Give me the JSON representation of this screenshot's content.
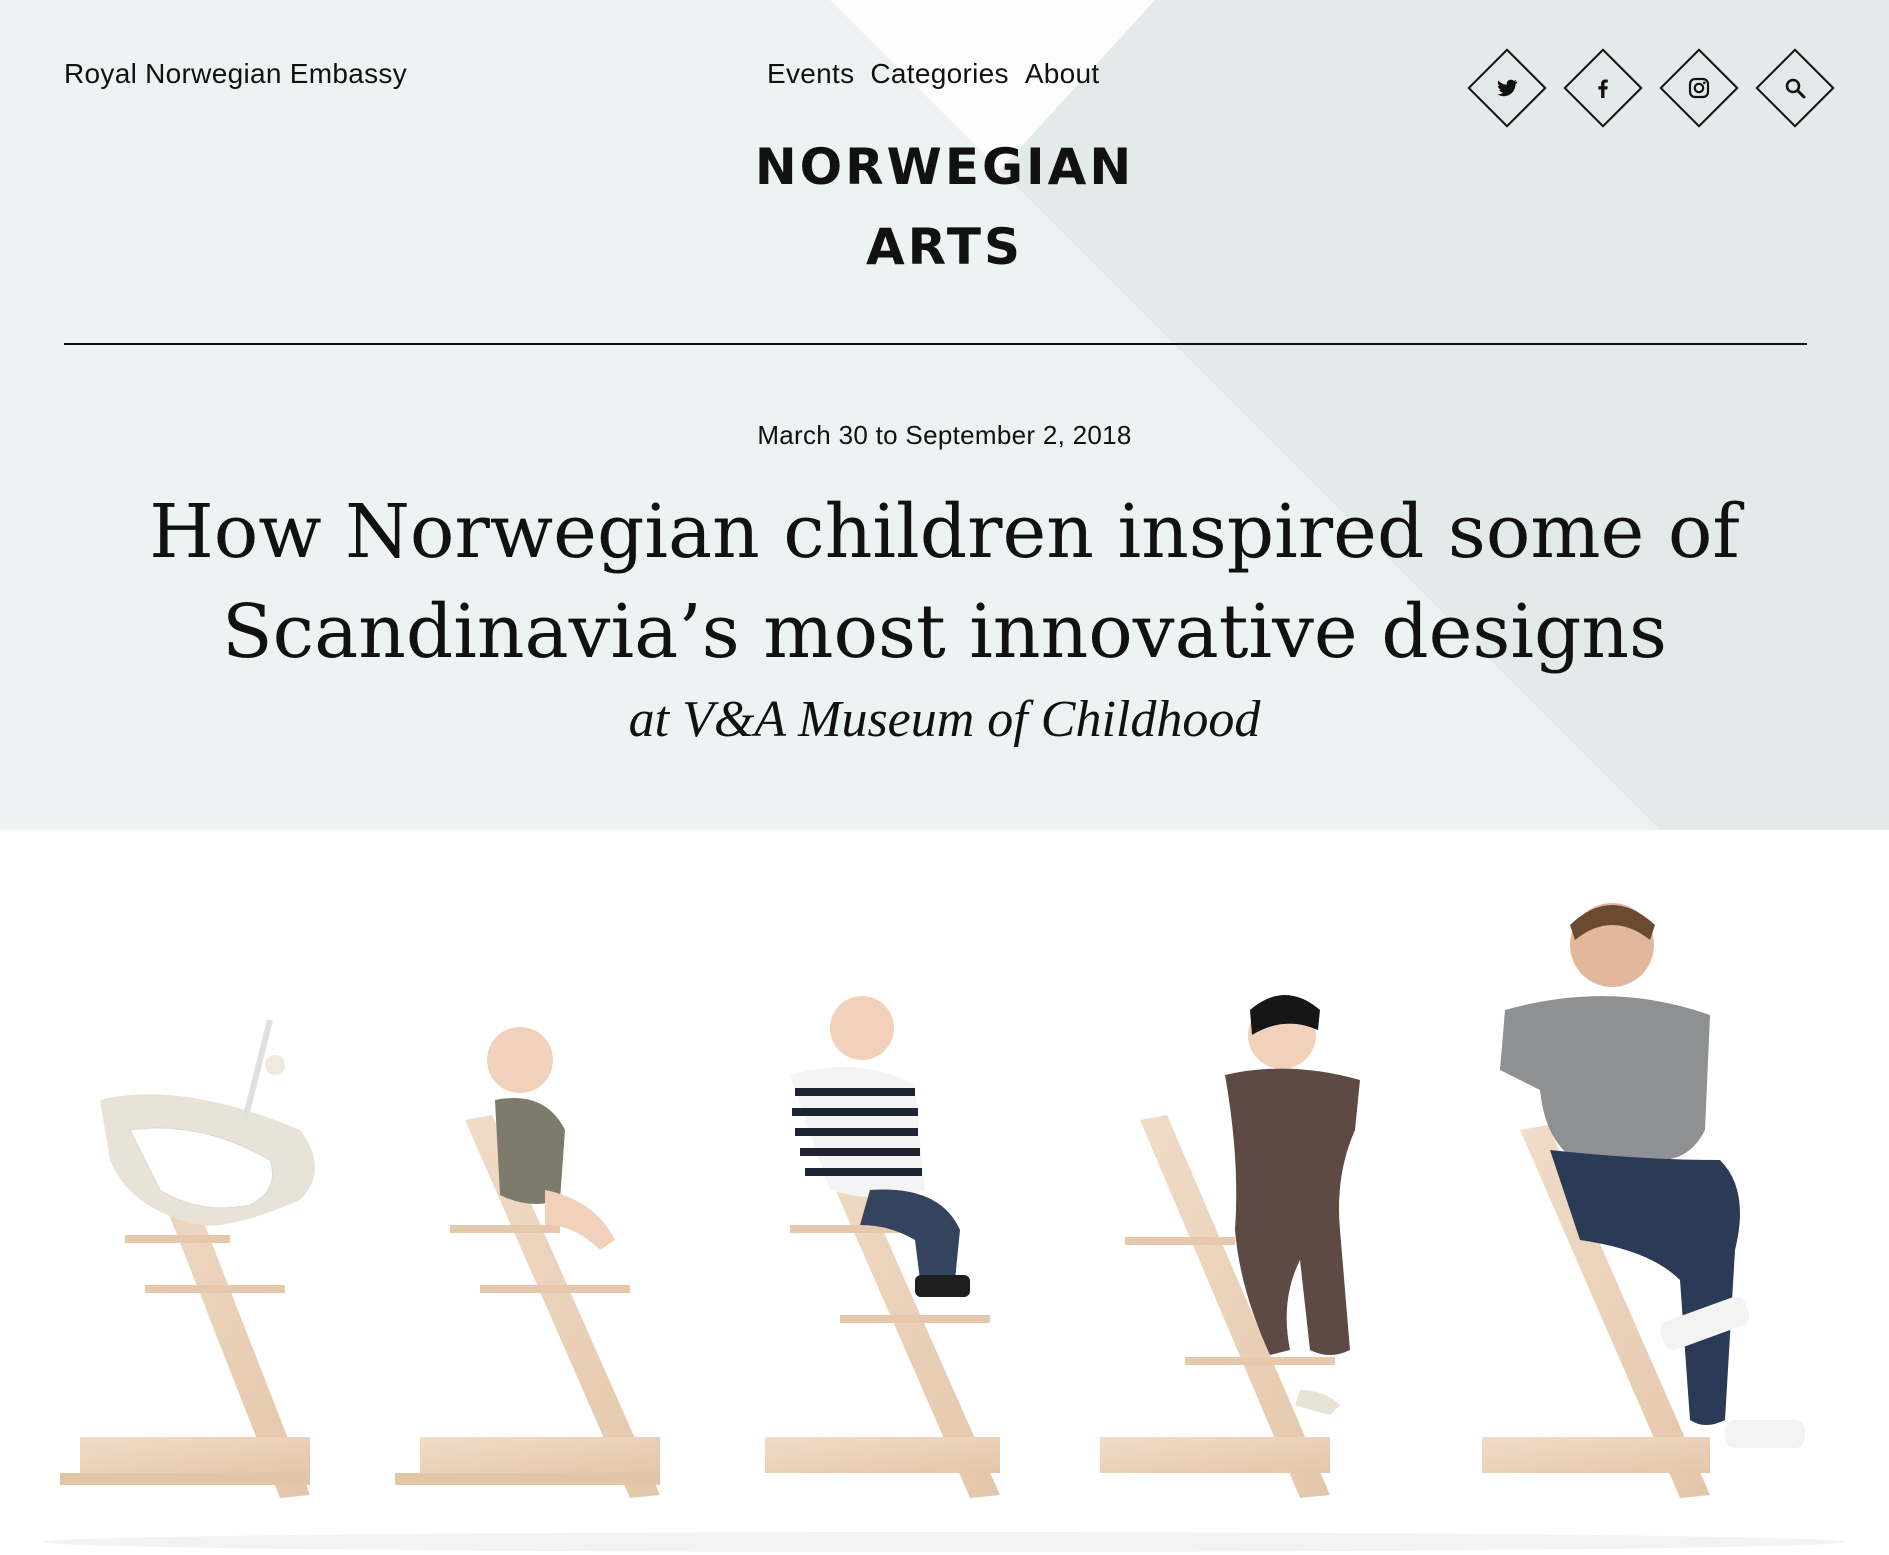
{
  "header": {
    "embassy": "Royal Norwegian Embassy",
    "nav": [
      "Events",
      "Categories",
      "About"
    ],
    "logo_line1": "NORWEGIAN",
    "logo_line2": "ARTS",
    "social": [
      "twitter-icon",
      "facebook-icon",
      "instagram-icon",
      "search-icon"
    ]
  },
  "article": {
    "date": "March 30 to September 2, 2018",
    "title_line1": "How Norwegian children inspired some of",
    "title_line2": "Scandinavia’s most innovative designs",
    "subtitle": "at V&A Museum of Childhood"
  },
  "colors": {
    "hero_bg": "#edf2f2",
    "hero_shape": "#e2e9e9",
    "wood": "#ecd2bb",
    "ink": "#111111"
  }
}
